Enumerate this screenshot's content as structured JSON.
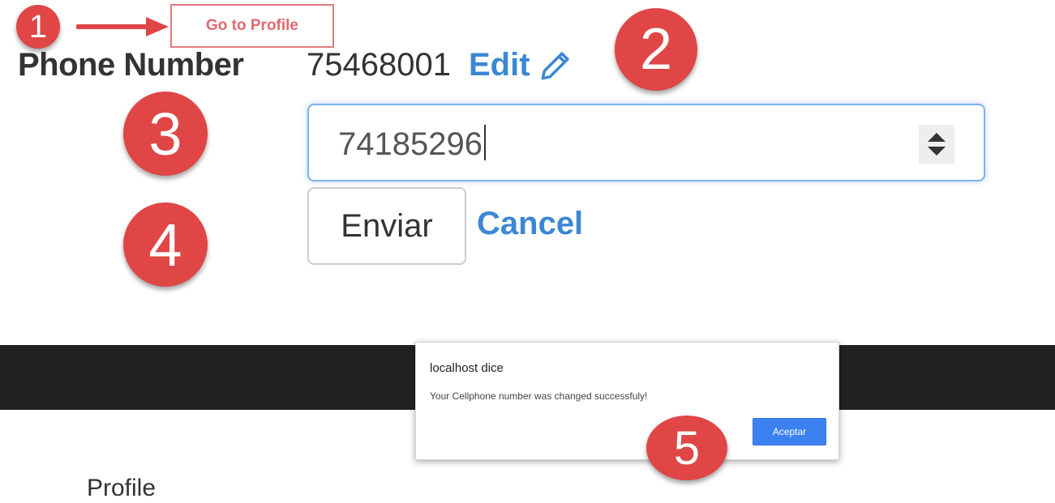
{
  "markers": {
    "step1": "1",
    "step2": "2",
    "step3": "3",
    "step4": "4",
    "step5": "5"
  },
  "marker_color": "#e04646",
  "goto_profile_label": "Go to Profile",
  "phone": {
    "label": "Phone Number",
    "current_value": "75468001",
    "edit_label": "Edit",
    "edit_icon": "pencil-icon"
  },
  "phone_input": {
    "value": "74185296",
    "spinner_icon": "number-spinner-icon"
  },
  "form_actions": {
    "submit_label": "Enviar",
    "cancel_label": "Cancel"
  },
  "alert_dialog": {
    "title": "localhost dice",
    "message": "Your Cellphone number was changed successfuly!",
    "accept_label": "Aceptar"
  },
  "nav": {
    "profile_label": "Profile"
  },
  "colors": {
    "link": "#3b87d4",
    "dark_bar": "#222222",
    "accept_button": "#3b82f0"
  }
}
